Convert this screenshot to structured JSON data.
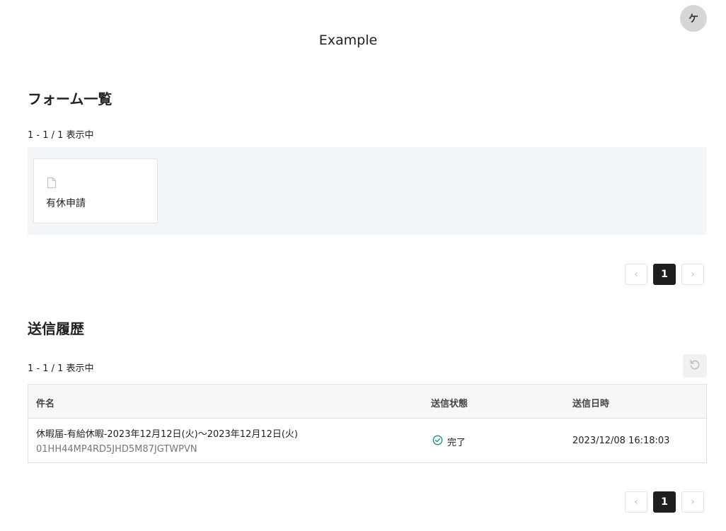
{
  "header": {
    "app_title": "Example",
    "avatar_initial": "ケ"
  },
  "forms_section": {
    "title": "フォーム一覧",
    "count_text": "1 - 1 / 1 表示中",
    "forms": [
      {
        "name": "有休申請",
        "icon": "document-icon"
      }
    ],
    "pagination": {
      "prev": "‹",
      "current_page": "1",
      "next": "›"
    }
  },
  "history_section": {
    "title": "送信履歴",
    "count_text": "1 - 1 / 1 表示中",
    "refresh_icon": "refresh-icon",
    "table": {
      "columns": [
        "件名",
        "送信状態",
        "送信日時"
      ],
      "rows": [
        {
          "subject": "休暇届-有給休暇-2023年12月12日(火)〜2023年12月12日(火)",
          "id": "01HH44MP4RD5JHD5M87JGTWPVN",
          "status": "完了",
          "status_icon": "check-circle-icon",
          "sent_at": "2023/12/08 16:18:03"
        }
      ]
    },
    "pagination": {
      "prev": "‹",
      "current_page": "1",
      "next": "›"
    }
  },
  "colors": {
    "forms_background": "#f3f6f9",
    "active_page": "#1e1e1e",
    "status_ok": "#1a8a7a"
  }
}
